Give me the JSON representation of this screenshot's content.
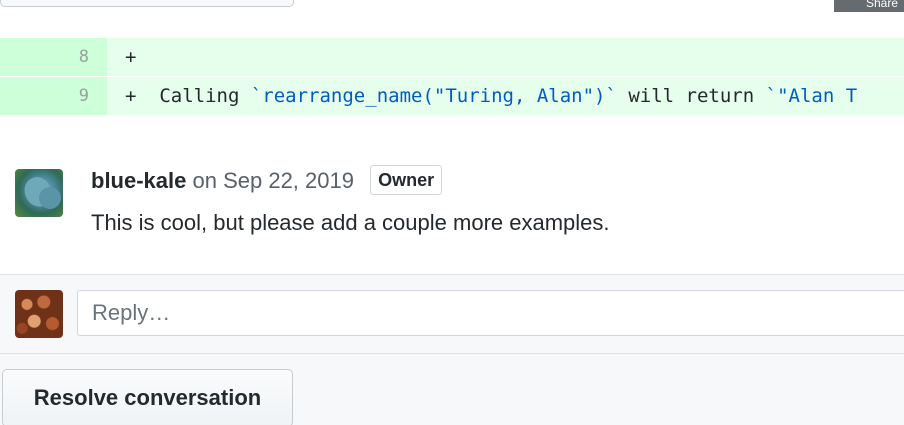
{
  "header": {
    "share_label": "Share"
  },
  "diff": {
    "lines": [
      {
        "number": "8",
        "marker": "+",
        "code": ""
      },
      {
        "number": "9",
        "marker": "+",
        "code_prefix": "Calling ",
        "code_inline": "`rearrange_name(\"Turing, Alan\")`",
        "code_middle": " will return ",
        "code_suffix": "`\"Alan T"
      }
    ]
  },
  "comment": {
    "author": "blue-kale",
    "date_text": "on Sep 22, 2019",
    "badge": "Owner",
    "body": "This is cool, but please add a couple more examples."
  },
  "reply": {
    "placeholder": "Reply…"
  },
  "actions": {
    "resolve_label": "Resolve conversation"
  }
}
